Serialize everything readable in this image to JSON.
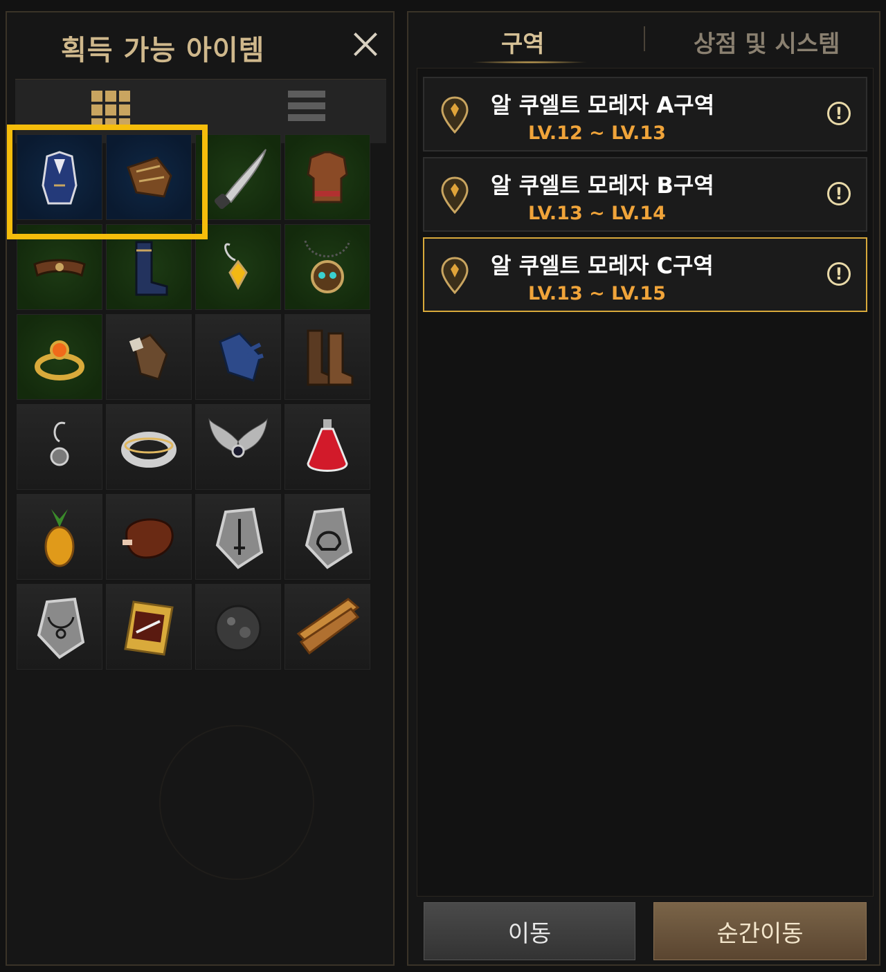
{
  "left_panel": {
    "title": "획득 가능 아이템",
    "close_icon": "close-icon",
    "view_tabs": [
      {
        "name": "grid-view",
        "icon": "grid-icon",
        "active": true
      },
      {
        "name": "list-view",
        "icon": "list-icon",
        "active": false
      }
    ],
    "items": [
      {
        "name": "blue-coat",
        "grade": "blue"
      },
      {
        "name": "leather-gauntlet",
        "grade": "blue"
      },
      {
        "name": "curved-dagger",
        "grade": "green"
      },
      {
        "name": "leather-armor",
        "grade": "green"
      },
      {
        "name": "leather-belt",
        "grade": "green"
      },
      {
        "name": "blue-boots",
        "grade": "green"
      },
      {
        "name": "yellow-gem-earring",
        "grade": "green"
      },
      {
        "name": "gem-necklace",
        "grade": "green"
      },
      {
        "name": "gold-ring",
        "grade": "green"
      },
      {
        "name": "brown-gloves",
        "grade": "gray"
      },
      {
        "name": "blue-gloves",
        "grade": "gray"
      },
      {
        "name": "brown-boots",
        "grade": "gray"
      },
      {
        "name": "silver-earring",
        "grade": "gray"
      },
      {
        "name": "silver-ring",
        "grade": "gray"
      },
      {
        "name": "winged-necklace",
        "grade": "gray"
      },
      {
        "name": "red-potion",
        "grade": "gray"
      },
      {
        "name": "pineapple",
        "grade": "gray"
      },
      {
        "name": "roasted-meat",
        "grade": "gray"
      },
      {
        "name": "sword-rune-stone",
        "grade": "gray"
      },
      {
        "name": "helmet-rune-stone",
        "grade": "gray"
      },
      {
        "name": "necklace-rune-stone",
        "grade": "gray"
      },
      {
        "name": "skill-scroll",
        "grade": "gray"
      },
      {
        "name": "black-ore",
        "grade": "gray"
      },
      {
        "name": "wood-plank",
        "grade": "gray"
      }
    ],
    "colors": {
      "highlight": "#f5bd0b",
      "title": "#cfb88c"
    }
  },
  "right_panel": {
    "tabs": [
      {
        "label": "구역",
        "active": true
      },
      {
        "label": "상점 및 시스템",
        "active": false
      }
    ],
    "zones": [
      {
        "name": "알 쿠엘트 모레자 A구역",
        "level": "LV.12 ~ LV.13",
        "selected": false
      },
      {
        "name": "알 쿠엘트 모레자 B구역",
        "level": "LV.13 ~ LV.14",
        "selected": false
      },
      {
        "name": "알 쿠엘트 모레자 C구역",
        "level": "LV.13 ~ LV.15",
        "selected": true
      }
    ],
    "info_glyph": "!",
    "buttons": {
      "move": "이동",
      "teleport": "순간이동"
    },
    "colors": {
      "level": "#f0a43a",
      "selected_border": "#d9aa3b"
    }
  }
}
